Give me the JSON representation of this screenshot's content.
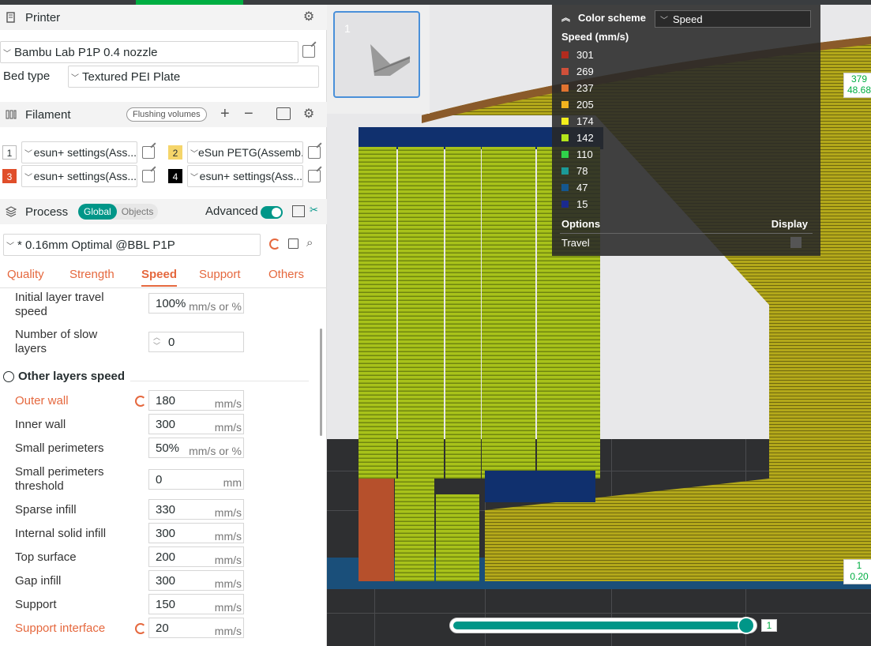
{
  "printer": {
    "title": "Printer",
    "model": "Bambu Lab P1P 0.4 nozzle",
    "bed_label": "Bed type",
    "bed_value": "Textured PEI Plate"
  },
  "filament": {
    "title": "Filament",
    "flushing_label": "Flushing volumes",
    "items": [
      {
        "num": "1",
        "name": "esun+ settings(Ass...",
        "color": "#ffffff",
        "text_color": "#262e30"
      },
      {
        "num": "2",
        "name": "eSun PETG(Assemb...",
        "color": "#f5d56a",
        "text_color": "#262e30"
      },
      {
        "num": "3",
        "name": "esun+ settings(Ass...",
        "color": "#e04e2a",
        "text_color": "#ffffff"
      },
      {
        "num": "4",
        "name": "esun+ settings(Ass...",
        "color": "#000000",
        "text_color": "#ffffff"
      }
    ]
  },
  "process": {
    "title": "Process",
    "global_label": "Global",
    "objects_label": "Objects",
    "advanced_label": "Advanced",
    "profile": "* 0.16mm Optimal @BBL P1P",
    "tabs": [
      "Quality",
      "Strength",
      "Speed",
      "Support",
      "Others"
    ],
    "active_tab": "Speed",
    "group_title": "Other layers speed",
    "params": [
      {
        "label": "Initial layer travel speed",
        "value": "100%",
        "unit": "mm/s or %",
        "modified": false
      },
      {
        "label": "Number of slow layers",
        "value": "0",
        "unit": "",
        "modified": false
      },
      {
        "label": "Outer wall",
        "value": "180",
        "unit": "mm/s",
        "modified": true
      },
      {
        "label": "Inner wall",
        "value": "300",
        "unit": "mm/s",
        "modified": false
      },
      {
        "label": "Small perimeters",
        "value": "50%",
        "unit": "mm/s or %",
        "modified": false
      },
      {
        "label": "Small perimeters threshold",
        "value": "0",
        "unit": "mm",
        "modified": false
      },
      {
        "label": "Sparse infill",
        "value": "330",
        "unit": "mm/s",
        "modified": false
      },
      {
        "label": "Internal solid infill",
        "value": "300",
        "unit": "mm/s",
        "modified": false
      },
      {
        "label": "Top surface",
        "value": "200",
        "unit": "mm/s",
        "modified": false
      },
      {
        "label": "Gap infill",
        "value": "300",
        "unit": "mm/s",
        "modified": false
      },
      {
        "label": "Support",
        "value": "150",
        "unit": "mm/s",
        "modified": false
      },
      {
        "label": "Support interface",
        "value": "20",
        "unit": "mm/s",
        "modified": true
      }
    ]
  },
  "viewport": {
    "plate_number": "1",
    "legend": {
      "header": "Color scheme",
      "scheme": "Speed",
      "subtitle": "Speed (mm/s)",
      "items": [
        {
          "value": "301",
          "color": "#b22b1e"
        },
        {
          "value": "269",
          "color": "#d0503a"
        },
        {
          "value": "237",
          "color": "#e07330"
        },
        {
          "value": "205",
          "color": "#f2b21e"
        },
        {
          "value": "174",
          "color": "#f4ef1c"
        },
        {
          "value": "142",
          "color": "#b3e51b"
        },
        {
          "value": "110",
          "color": "#2fd14a"
        },
        {
          "value": "78",
          "color": "#1b9a97"
        },
        {
          "value": "47",
          "color": "#15578f"
        },
        {
          "value": "15",
          "color": "#1a2a8f"
        }
      ],
      "options_label": "Options",
      "display_label": "Display",
      "travel_label": "Travel"
    },
    "layer_top": {
      "layer": "379",
      "height": "48.68"
    },
    "layer_bottom": {
      "layer": "1",
      "height": "0.20"
    },
    "horizontal_slider": {
      "value_label": "1",
      "position_fraction": 0.98
    }
  }
}
